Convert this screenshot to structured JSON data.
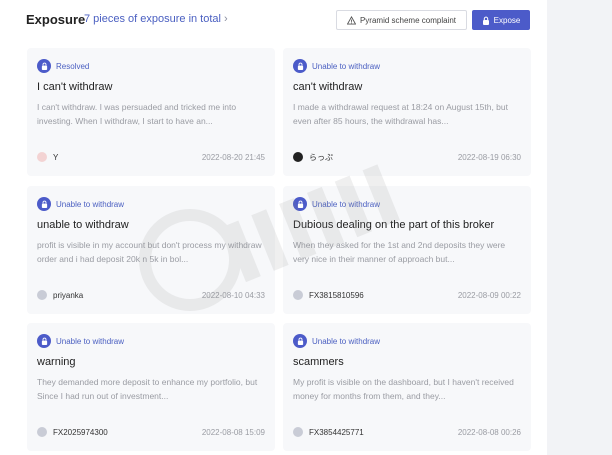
{
  "header": {
    "title": "Exposure",
    "count_text": "7 pieces of exposure in total",
    "complaint_label": "Pyramid scheme complaint",
    "expose_label": "Expose"
  },
  "colors": {
    "accent": "#4c5bc9",
    "badge_text": "#4a5fc1",
    "muted": "#9a9ca3"
  },
  "cards": [
    {
      "status": "Resolved",
      "title": "I can't withdraw",
      "body": "I can't withdraw. I was persuaded and tricked me into investing. When I withdraw, I start to have an...",
      "user": "Y",
      "date": "2022-08-20 21:45"
    },
    {
      "status": "Unable to withdraw",
      "title": "can't withdraw",
      "body": "I made a withdrawal request at 18:24 on August 15th, but even after 85 hours, the withdrawal has...",
      "user": "らっぷ",
      "date": "2022-08-19 06:30"
    },
    {
      "status": "Unable to withdraw",
      "title": "unable to withdraw",
      "body": "profit is visible in my account but don't process my withdraw order and i had deposit 20k n 5k in bol...",
      "user": "priyanka",
      "date": "2022-08-10 04:33"
    },
    {
      "status": "Unable to withdraw",
      "title": "Dubious dealing on the part of this broker",
      "body": "When they asked for the 1st and 2nd deposits they were very nice in their manner of approach but...",
      "user": "FX3815810596",
      "date": "2022-08-09 00:22"
    },
    {
      "status": "Unable to withdraw",
      "title": "warning",
      "body": "They demanded more deposit to enhance my portfolio, but Since I had run out of investment...",
      "user": "FX2025974300",
      "date": "2022-08-08 15:09"
    },
    {
      "status": "Unable to withdraw",
      "title": "scammers",
      "body": "My profit is visible on the dashboard, but I haven't received money for months from them, and they...",
      "user": "FX3854425771",
      "date": "2022-08-08 00:26"
    }
  ]
}
